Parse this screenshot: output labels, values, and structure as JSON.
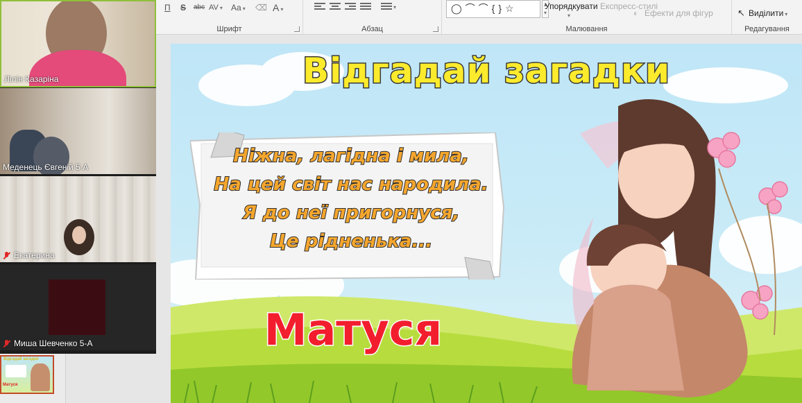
{
  "ribbon": {
    "font_tools": [
      "П",
      "S",
      "abc",
      "AV",
      "Aa",
      "A"
    ],
    "paragraph_tools": [
      "align-left",
      "align-center",
      "align-right",
      "justify",
      "bullets",
      "numbering"
    ],
    "shape_symbols": "◯⌒⌒{}☆",
    "groups": {
      "font": "Шрифт",
      "paragraph": "Абзац",
      "drawing": "Малювання",
      "editing": "Редагування"
    },
    "arrange_label": "Упорядкувати",
    "quick_styles_label": "Експресс-стилі",
    "shape_effects_label": "Ефекти для фігур",
    "select_label": "Виділити"
  },
  "participants": [
    {
      "name": "Лілія Казаріна",
      "muted": false
    },
    {
      "name": "Меденець Євгеній 5 А",
      "muted": false
    },
    {
      "name": "Екатерина",
      "muted": true
    },
    {
      "name": "Миша Шевченко 5-А",
      "muted": true
    }
  ],
  "slide": {
    "title": "Відгадай загадки",
    "poem": [
      "Ніжна, лагідна і мила,",
      "На цей світ нас народила.",
      "Я до неї пригорнуся,",
      "Це рідненька..."
    ],
    "answer": "Матуся"
  },
  "thumbnail": {
    "title": "Відгадай загадки",
    "answer": "Матуся"
  },
  "colors": {
    "title_fill": "#fbeb2c",
    "poem_fill": "#f4a62e",
    "answer_fill": "#f21e2e",
    "active_speaker": "#8fbf3a",
    "muted_icon": "#e02828"
  }
}
